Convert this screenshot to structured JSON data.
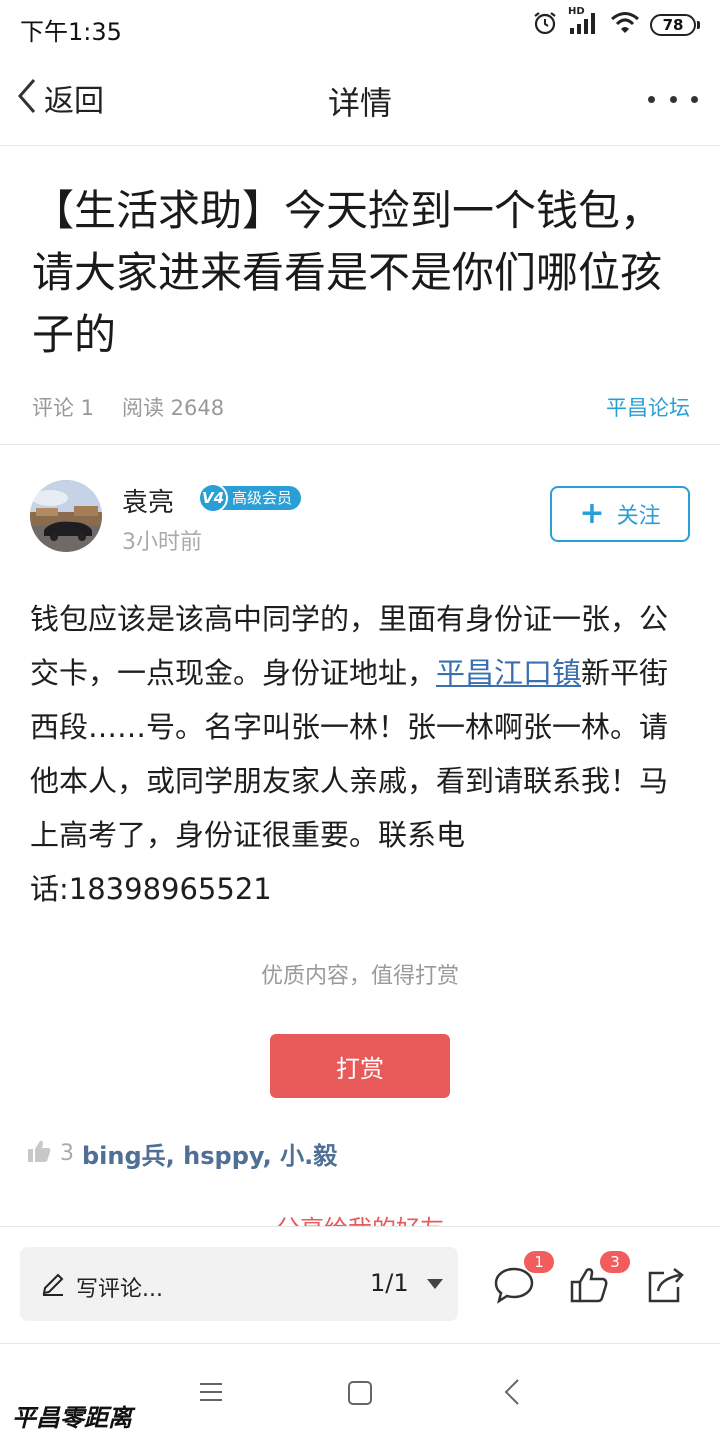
{
  "status_bar": {
    "time": "下午1:35",
    "network": "HD",
    "battery": "78"
  },
  "nav": {
    "back_label": "返回",
    "title": "详情"
  },
  "post": {
    "title": "【生活求助】今天捡到一个钱包，请大家进来看看是不是你们哪位孩子的",
    "comments": "评论 1",
    "reads": "阅读 2648",
    "forum": "平昌论坛"
  },
  "author": {
    "name": "袁亮",
    "level": "V4",
    "badge": "高级会员",
    "time": "3小时前",
    "follow_label": "关注"
  },
  "body": {
    "part1": "钱包应该是该高中同学的，里面有身份证一张，公交卡，一点现金。身份证地址，",
    "link": "平昌江口镇",
    "part2": "新平街西段……号。名字叫张一林！张一林啊张一林。请他本人，或同学朋友家人亲戚，看到请联系我！马上高考了，身份证很重要。联系电话:18398965521"
  },
  "reward": {
    "hint": "优质内容，值得打赏",
    "button": "打赏"
  },
  "likes": {
    "count": "3",
    "names": "bing兵, hsppy, 小.毅"
  },
  "cutoff_text": "分享给我的好友",
  "bottom_bar": {
    "comment_placeholder": "写评论...",
    "pager": "1/1",
    "comment_badge": "1",
    "like_badge": "3"
  },
  "watermark": "平昌零距离",
  "colors": {
    "accent": "#2a9fd6",
    "reward": "#e85a5a",
    "badge_red": "#f25c5c",
    "link": "#3a6fb0"
  }
}
